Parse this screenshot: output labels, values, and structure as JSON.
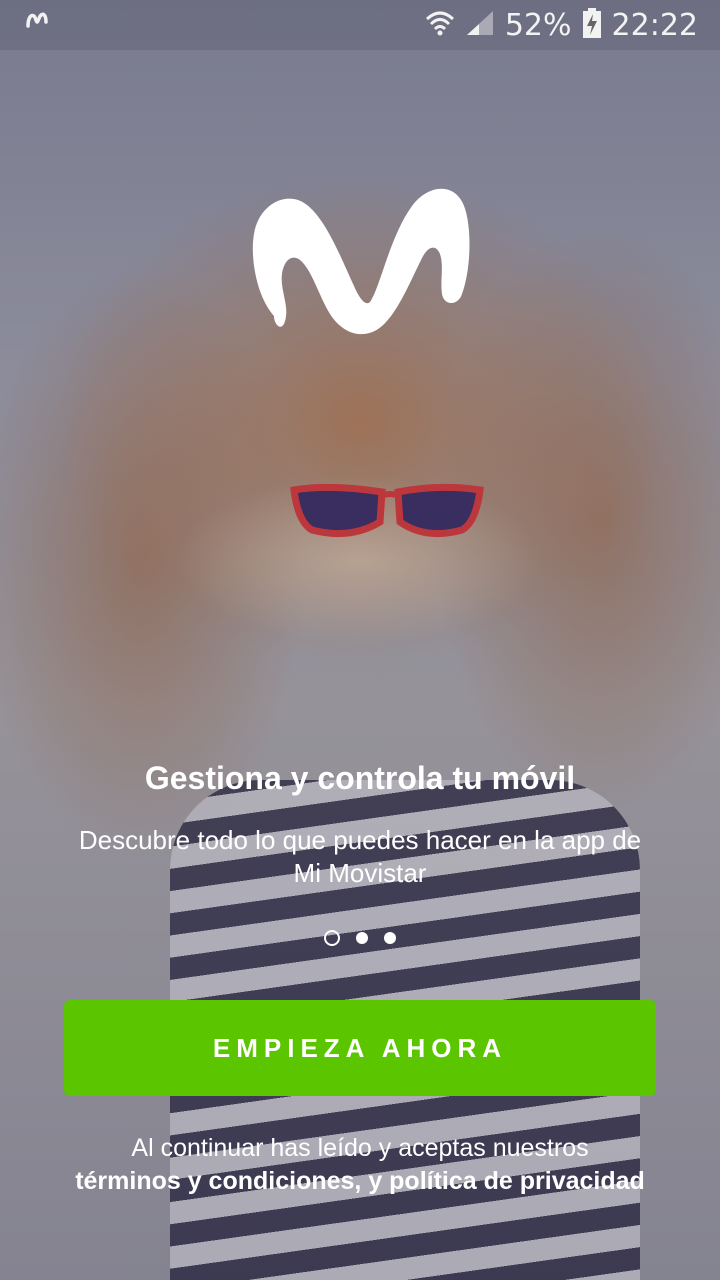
{
  "status_bar": {
    "app_icon": "movistar-m-icon",
    "wifi_icon": "wifi-icon",
    "signal_icon": "signal-icon",
    "battery_percent": "52%",
    "battery_icon": "battery-charging-icon",
    "time": "22:22"
  },
  "brand": {
    "logo": "movistar-m-logo"
  },
  "onboarding": {
    "title": "Gestiona y controla tu móvil",
    "subtitle": "Descubre todo lo que puedes hacer en la app de Mi Movistar",
    "pager": {
      "total": 3,
      "active_index": 0
    },
    "cta_label": "EMPIEZA AHORA",
    "cta_color": "#5bc500"
  },
  "legal": {
    "line1": "Al continuar has leído y aceptas nuestros",
    "terms_link": "términos y condiciones, y política de privacidad"
  }
}
